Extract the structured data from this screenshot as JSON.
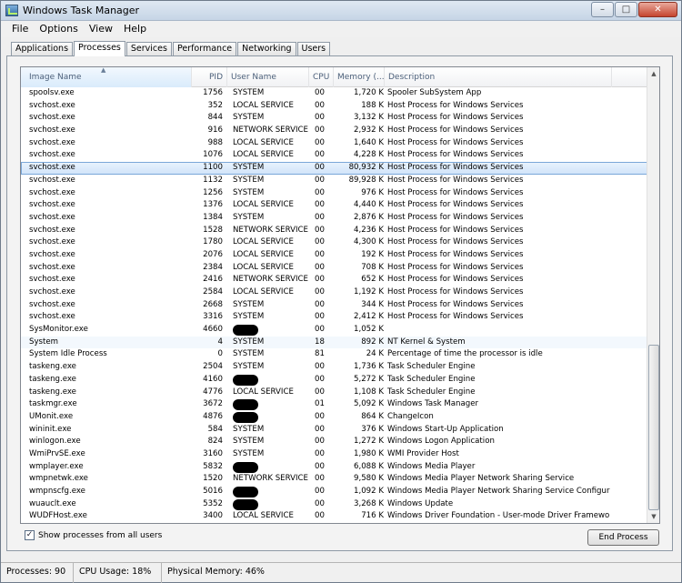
{
  "window": {
    "title": "Windows Task Manager",
    "buttons": {
      "minimize": "–",
      "maximize": "□",
      "close": "✕"
    }
  },
  "menu": [
    "File",
    "Options",
    "View",
    "Help"
  ],
  "tabs": [
    "Applications",
    "Processes",
    "Services",
    "Performance",
    "Networking",
    "Users"
  ],
  "active_tab": "Processes",
  "columns": {
    "image_name": "Image Name",
    "pid": "PID",
    "user_name": "User Name",
    "cpu": "CPU",
    "memory": "Memory (...",
    "description": "Description"
  },
  "sort_indicator": "▲",
  "processes": [
    {
      "name": "spoolsv.exe",
      "pid": "1756",
      "user": "SYSTEM",
      "cpu": "00",
      "mem": "1,720 K",
      "desc": "Spooler SubSystem App"
    },
    {
      "name": "svchost.exe",
      "pid": "352",
      "user": "LOCAL SERVICE",
      "cpu": "00",
      "mem": "188 K",
      "desc": "Host Process for Windows Services"
    },
    {
      "name": "svchost.exe",
      "pid": "844",
      "user": "SYSTEM",
      "cpu": "00",
      "mem": "3,132 K",
      "desc": "Host Process for Windows Services"
    },
    {
      "name": "svchost.exe",
      "pid": "916",
      "user": "NETWORK SERVICE",
      "cpu": "00",
      "mem": "2,932 K",
      "desc": "Host Process for Windows Services"
    },
    {
      "name": "svchost.exe",
      "pid": "988",
      "user": "LOCAL SERVICE",
      "cpu": "00",
      "mem": "1,640 K",
      "desc": "Host Process for Windows Services"
    },
    {
      "name": "svchost.exe",
      "pid": "1076",
      "user": "LOCAL SERVICE",
      "cpu": "00",
      "mem": "4,228 K",
      "desc": "Host Process for Windows Services"
    },
    {
      "name": "svchost.exe",
      "pid": "1100",
      "user": "SYSTEM",
      "cpu": "00",
      "mem": "80,932 K",
      "desc": "Host Process for Windows Services",
      "state": "selected"
    },
    {
      "name": "svchost.exe",
      "pid": "1132",
      "user": "SYSTEM",
      "cpu": "00",
      "mem": "89,928 K",
      "desc": "Host Process for Windows Services"
    },
    {
      "name": "svchost.exe",
      "pid": "1256",
      "user": "SYSTEM",
      "cpu": "00",
      "mem": "976 K",
      "desc": "Host Process for Windows Services"
    },
    {
      "name": "svchost.exe",
      "pid": "1376",
      "user": "LOCAL SERVICE",
      "cpu": "00",
      "mem": "4,440 K",
      "desc": "Host Process for Windows Services"
    },
    {
      "name": "svchost.exe",
      "pid": "1384",
      "user": "SYSTEM",
      "cpu": "00",
      "mem": "2,876 K",
      "desc": "Host Process for Windows Services"
    },
    {
      "name": "svchost.exe",
      "pid": "1528",
      "user": "NETWORK SERVICE",
      "cpu": "00",
      "mem": "4,236 K",
      "desc": "Host Process for Windows Services"
    },
    {
      "name": "svchost.exe",
      "pid": "1780",
      "user": "LOCAL SERVICE",
      "cpu": "00",
      "mem": "4,300 K",
      "desc": "Host Process for Windows Services"
    },
    {
      "name": "svchost.exe",
      "pid": "2076",
      "user": "LOCAL SERVICE",
      "cpu": "00",
      "mem": "192 K",
      "desc": "Host Process for Windows Services"
    },
    {
      "name": "svchost.exe",
      "pid": "2384",
      "user": "LOCAL SERVICE",
      "cpu": "00",
      "mem": "708 K",
      "desc": "Host Process for Windows Services"
    },
    {
      "name": "svchost.exe",
      "pid": "2416",
      "user": "NETWORK SERVICE",
      "cpu": "00",
      "mem": "652 K",
      "desc": "Host Process for Windows Services"
    },
    {
      "name": "svchost.exe",
      "pid": "2584",
      "user": "LOCAL SERVICE",
      "cpu": "00",
      "mem": "1,192 K",
      "desc": "Host Process for Windows Services"
    },
    {
      "name": "svchost.exe",
      "pid": "2668",
      "user": "SYSTEM",
      "cpu": "00",
      "mem": "344 K",
      "desc": "Host Process for Windows Services"
    },
    {
      "name": "svchost.exe",
      "pid": "3316",
      "user": "SYSTEM",
      "cpu": "00",
      "mem": "2,412 K",
      "desc": "Host Process for Windows Services"
    },
    {
      "name": "SysMonitor.exe",
      "pid": "4660",
      "user": "",
      "redacted": true,
      "cpu": "00",
      "mem": "1,052 K",
      "desc": ""
    },
    {
      "name": "System",
      "pid": "4",
      "user": "SYSTEM",
      "cpu": "18",
      "mem": "892 K",
      "desc": "NT Kernel & System",
      "state": "hover"
    },
    {
      "name": "System Idle Process",
      "pid": "0",
      "user": "SYSTEM",
      "cpu": "81",
      "mem": "24 K",
      "desc": "Percentage of time the processor is idle"
    },
    {
      "name": "taskeng.exe",
      "pid": "2504",
      "user": "SYSTEM",
      "cpu": "00",
      "mem": "1,736 K",
      "desc": "Task Scheduler Engine"
    },
    {
      "name": "taskeng.exe",
      "pid": "4160",
      "user": "",
      "redacted": true,
      "cpu": "00",
      "mem": "5,272 K",
      "desc": "Task Scheduler Engine"
    },
    {
      "name": "taskeng.exe",
      "pid": "4776",
      "user": "LOCAL SERVICE",
      "cpu": "00",
      "mem": "1,108 K",
      "desc": "Task Scheduler Engine"
    },
    {
      "name": "taskmgr.exe",
      "pid": "3672",
      "user": "",
      "redacted": true,
      "cpu": "01",
      "mem": "5,092 K",
      "desc": "Windows Task Manager"
    },
    {
      "name": "UMonit.exe",
      "pid": "4876",
      "user": "",
      "redacted": true,
      "cpu": "00",
      "mem": "864 K",
      "desc": "ChangeIcon"
    },
    {
      "name": "wininit.exe",
      "pid": "584",
      "user": "SYSTEM",
      "cpu": "00",
      "mem": "376 K",
      "desc": "Windows Start-Up Application"
    },
    {
      "name": "winlogon.exe",
      "pid": "824",
      "user": "SYSTEM",
      "cpu": "00",
      "mem": "1,272 K",
      "desc": "Windows Logon Application"
    },
    {
      "name": "WmiPrvSE.exe",
      "pid": "3160",
      "user": "SYSTEM",
      "cpu": "00",
      "mem": "1,980 K",
      "desc": "WMI Provider Host"
    },
    {
      "name": "wmplayer.exe",
      "pid": "5832",
      "user": "",
      "redacted": true,
      "cpu": "00",
      "mem": "6,088 K",
      "desc": "Windows Media Player"
    },
    {
      "name": "wmpnetwk.exe",
      "pid": "1520",
      "user": "NETWORK SERVICE",
      "cpu": "00",
      "mem": "9,580 K",
      "desc": "Windows Media Player Network Sharing Service"
    },
    {
      "name": "wmpnscfg.exe",
      "pid": "5016",
      "user": "",
      "redacted": true,
      "cpu": "00",
      "mem": "1,092 K",
      "desc": "Windows Media Player Network Sharing Service Configurati..."
    },
    {
      "name": "wuauclt.exe",
      "pid": "5352",
      "user": "",
      "redacted": true,
      "cpu": "00",
      "mem": "3,268 K",
      "desc": "Windows Update"
    },
    {
      "name": "WUDFHost.exe",
      "pid": "3400",
      "user": "LOCAL SERVICE",
      "cpu": "00",
      "mem": "716 K",
      "desc": "Windows Driver Foundation - User-mode Driver Framework ..."
    }
  ],
  "show_all_users": {
    "label": "Show processes from all users",
    "checked": true,
    "mark": "✓"
  },
  "end_process_label": "End Process",
  "scrollbar": {
    "up": "▲",
    "down": "▼"
  },
  "status": {
    "processes": "Processes: 90",
    "cpu_usage": "CPU Usage: 18%",
    "physical_memory": "Physical Memory: 46%"
  }
}
